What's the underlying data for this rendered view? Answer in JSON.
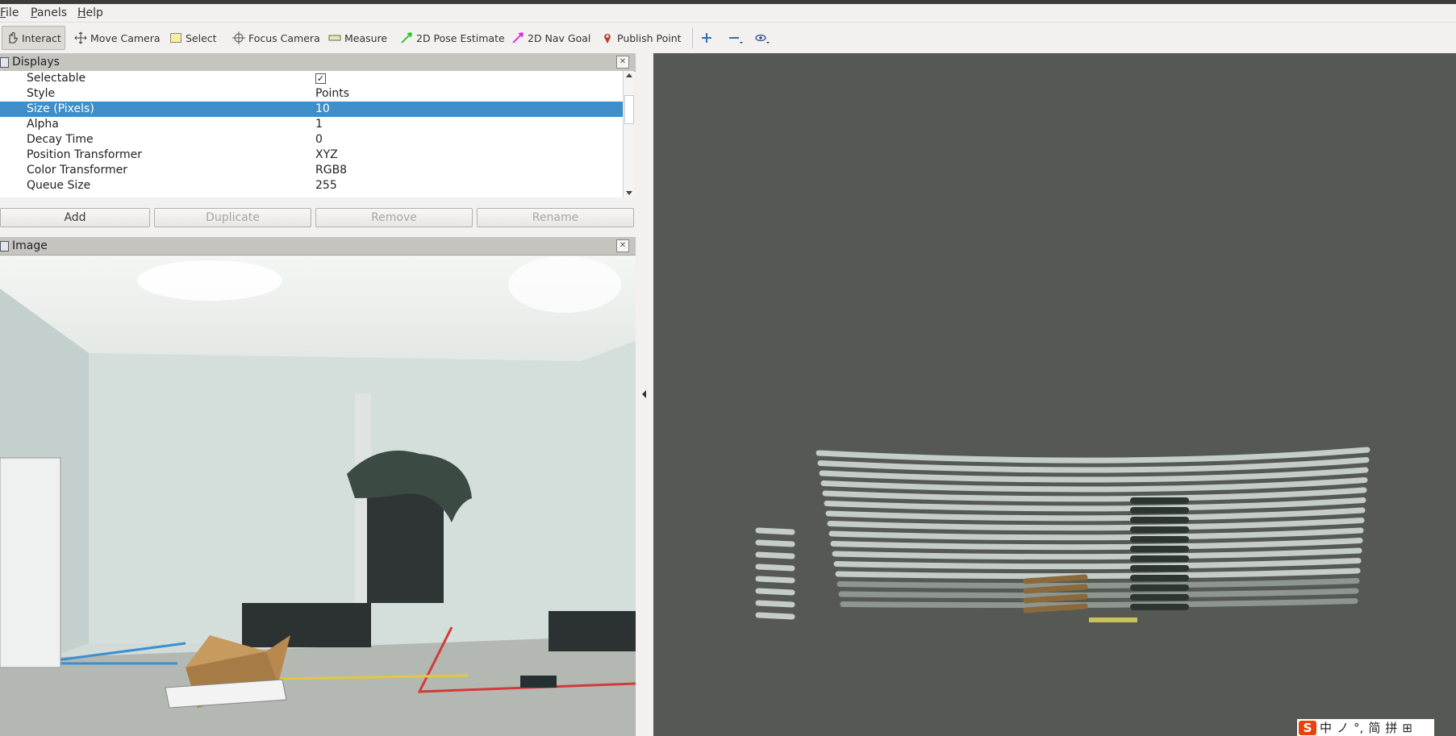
{
  "menu": [
    {
      "underline": "F",
      "rest": "ile"
    },
    {
      "underline": "P",
      "rest": "anels"
    },
    {
      "underline": "H",
      "rest": "elp"
    }
  ],
  "toolbar": {
    "interact": "Interact",
    "move_camera": "Move Camera",
    "select": "Select",
    "focus_camera": "Focus Camera",
    "measure": "Measure",
    "pose_estimate": "2D Pose Estimate",
    "nav_goal": "2D Nav Goal",
    "publish_point": "Publish Point"
  },
  "displays": {
    "title": "Displays",
    "properties": [
      {
        "key": "Selectable",
        "value": "✓",
        "type": "checkbox"
      },
      {
        "key": "Style",
        "value": "Points"
      },
      {
        "key": "Size (Pixels)",
        "value": "10",
        "selected": true
      },
      {
        "key": "Alpha",
        "value": "1"
      },
      {
        "key": "Decay Time",
        "value": "0"
      },
      {
        "key": "Position Transformer",
        "value": "XYZ"
      },
      {
        "key": "Color Transformer",
        "value": "RGB8"
      },
      {
        "key": "Queue Size",
        "value": "255"
      }
    ],
    "buttons": {
      "add": "Add",
      "duplicate": "Duplicate",
      "remove": "Remove",
      "rename": "Rename"
    }
  },
  "image_panel": {
    "title": "Image"
  },
  "ime": {
    "logo": "S",
    "items": [
      "中",
      "ノ",
      "°,",
      "简",
      "拼",
      "⊞"
    ]
  },
  "colors": {
    "selection": "#3d8ec9",
    "viewport_bg": "#565853",
    "panel_header": "#c6c4bf"
  }
}
